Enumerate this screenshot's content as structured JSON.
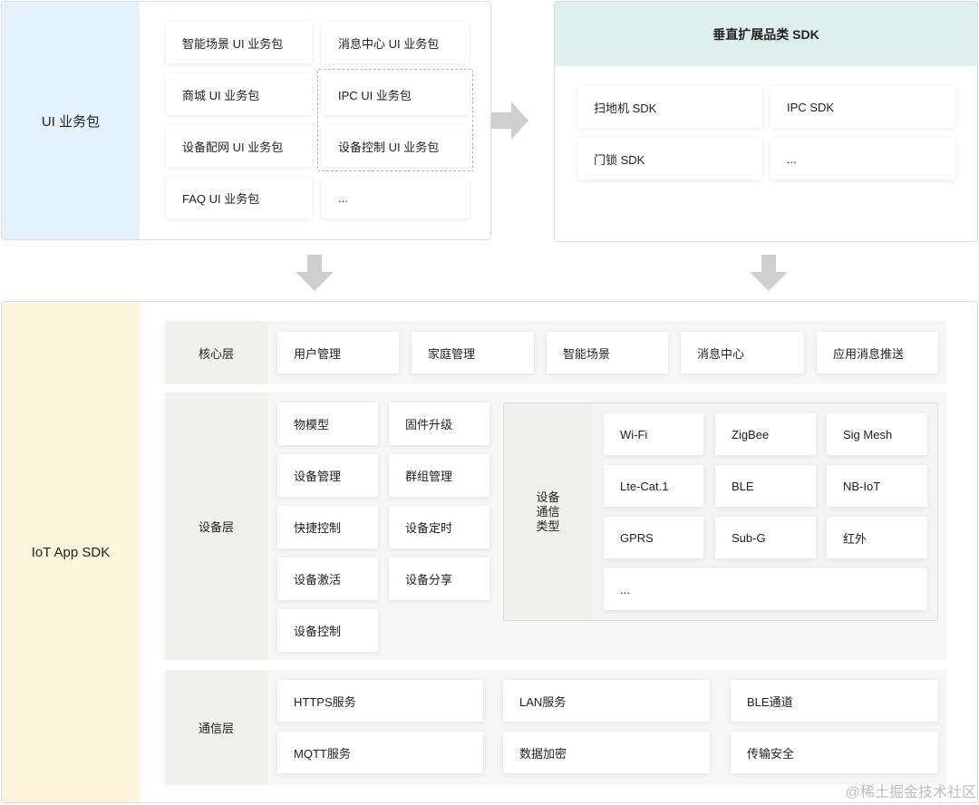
{
  "ui_packages": {
    "label": "UI 业务包",
    "items": [
      "智能场景 UI 业务包",
      "消息中心 UI 业务包",
      "商城 UI 业务包",
      "IPC UI 业务包",
      "设备配网 UI 业务包",
      "设备控制 UI 业务包",
      "FAQ UI 业务包",
      "..."
    ]
  },
  "vertical_sdk": {
    "title": "垂直扩展品类 SDK",
    "items": [
      "扫地机 SDK",
      "IPC SDK",
      "门锁 SDK",
      "..."
    ]
  },
  "iot_sdk": {
    "label": "IoT App SDK",
    "core_layer": {
      "label": "核心层",
      "items": [
        "用户管理",
        "家庭管理",
        "智能场景",
        "消息中心",
        "应用消息推送"
      ]
    },
    "device_layer": {
      "label": "设备层",
      "items": [
        "物模型",
        "固件升级",
        "设备管理",
        "群组管理",
        "快捷控制",
        "设备定时",
        "设备激活",
        "设备分享",
        "设备控制"
      ],
      "comm_types": {
        "label": "设备通信类型",
        "items": [
          "Wi-Fi",
          "ZigBee",
          "Sig Mesh",
          "Lte-Cat.1",
          "BLE",
          "NB-IoT",
          "GPRS",
          "Sub-G",
          "红外",
          "..."
        ]
      }
    },
    "comm_layer": {
      "label": "通信层",
      "items": [
        "HTTPS服务",
        "LAN服务",
        "BLE通道",
        "MQTT服务",
        "数据加密",
        "传输安全"
      ]
    }
  },
  "watermark": "@稀土掘金技术社区",
  "colors": {
    "ui_side": "#e3f2fd",
    "sdk_header": "#dff0ec",
    "iot_side": "#fdf5dc",
    "arrow": "#cfcfcf"
  }
}
